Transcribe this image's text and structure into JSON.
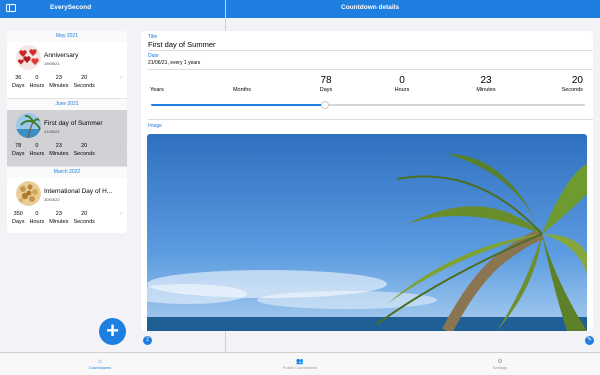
{
  "sidebar": {
    "title": "EverySecond",
    "sections": [
      {
        "header": "May 2021",
        "item": {
          "title": "Anniversary",
          "date": "19/05/21",
          "days": "36",
          "hours": "0",
          "minutes": "23",
          "seconds": "20"
        }
      },
      {
        "header": "June 2021",
        "item": {
          "title": "First day of Summer",
          "date": "21/06/21",
          "days": "78",
          "hours": "0",
          "minutes": "23",
          "seconds": "20"
        }
      },
      {
        "header": "March 2022",
        "item": {
          "title": "International Day of H...",
          "date": "20/03/22",
          "days": "350",
          "hours": "0",
          "minutes": "23",
          "seconds": "20"
        }
      }
    ],
    "stat_labels": {
      "days": "Days",
      "hours": "Hours",
      "minutes": "Minutes",
      "seconds": "Seconds"
    },
    "add_button": "+"
  },
  "detail": {
    "header_title": "Countdown details",
    "title_label": "Title",
    "title_value": "First day of Summer",
    "date_label": "Date",
    "date_value": "21/06/21, every 1 years",
    "units": [
      {
        "value": "",
        "label": "Years"
      },
      {
        "value": "",
        "label": "Months"
      },
      {
        "value": "78",
        "label": "Days"
      },
      {
        "value": "0",
        "label": "Hours"
      },
      {
        "value": "23",
        "label": "Minutes"
      },
      {
        "value": "20",
        "label": "Seconds"
      }
    ],
    "slider_value": 0.4,
    "image_label": "Image"
  },
  "tabs": [
    {
      "label": "Countdowns",
      "icon": "house-icon",
      "active": true
    },
    {
      "label": "Public Countdowns",
      "icon": "people-icon",
      "active": false
    },
    {
      "label": "Settings",
      "icon": "gear-icon",
      "active": false
    }
  ],
  "colors": {
    "accent": "#1f7fe0",
    "selected_row": "#d1d1d6"
  }
}
